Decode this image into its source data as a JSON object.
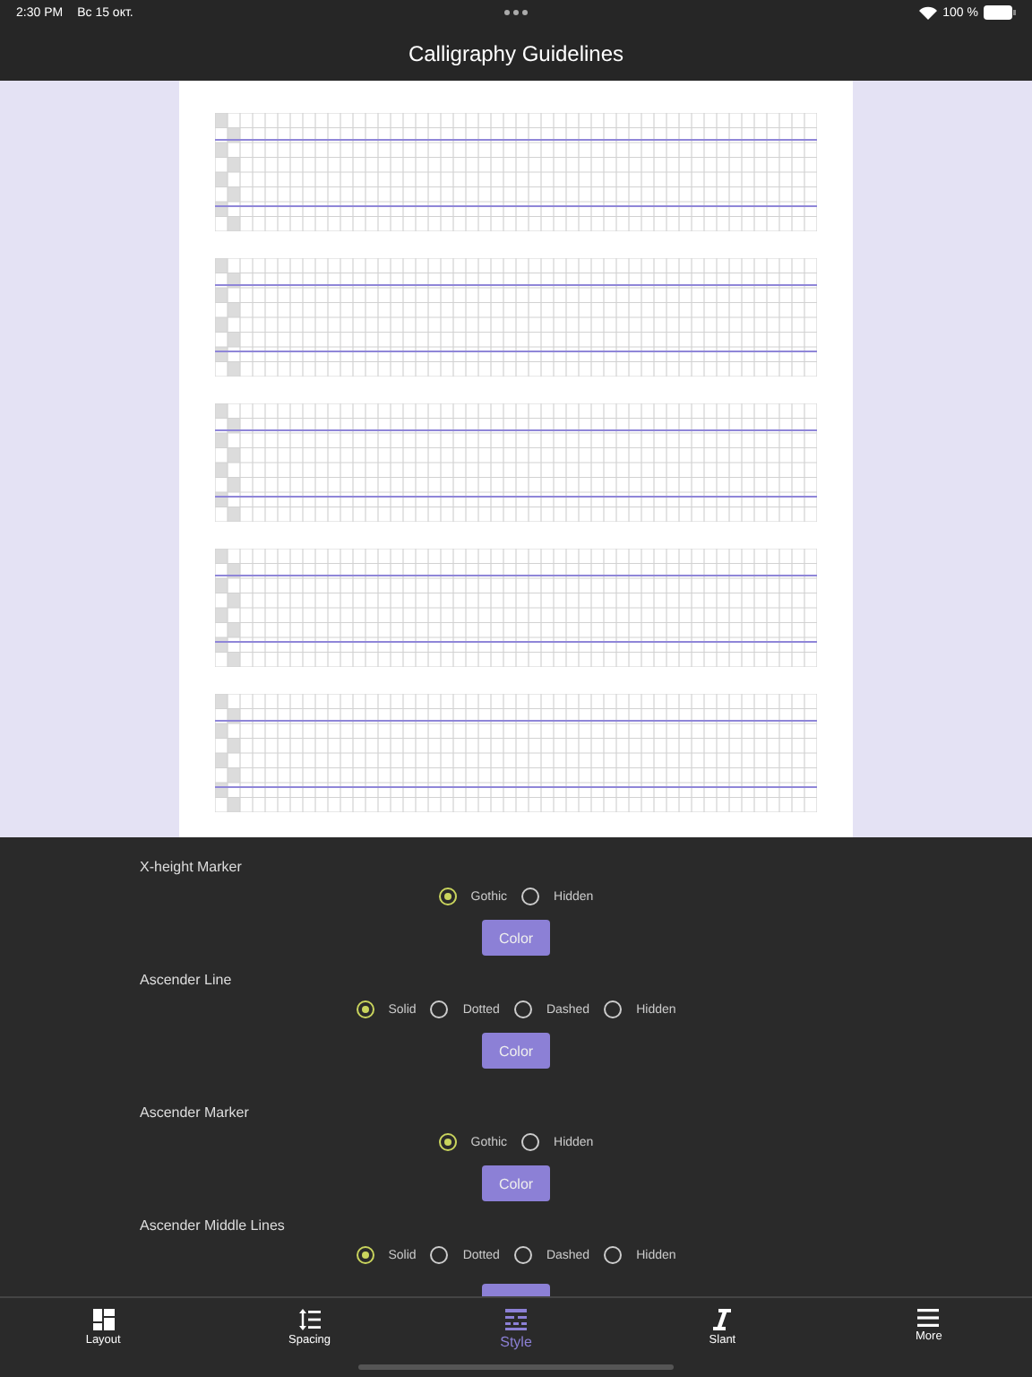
{
  "status_bar": {
    "time": "2:30 PM",
    "date": "Вс 15 окт.",
    "battery": "100 %"
  },
  "title": "Calligraphy Guidelines",
  "sheet": {
    "blocks": [
      {
        "kind": "grid"
      },
      {
        "kind": "grid"
      },
      {
        "kind": "grid"
      },
      {
        "kind": "grid"
      },
      {
        "kind": "grid"
      }
    ]
  },
  "settings": [
    {
      "label": "X-height Marker",
      "options": [
        {
          "label": "Gothic",
          "selected": true
        },
        {
          "label": "Hidden",
          "selected": false
        }
      ],
      "button": "Color"
    },
    {
      "label": "Ascender Line",
      "options": [
        {
          "label": "Solid",
          "selected": true
        },
        {
          "label": "Dotted",
          "selected": false
        },
        {
          "label": "Dashed",
          "selected": false
        },
        {
          "label": "Hidden",
          "selected": false
        }
      ],
      "button": "Color"
    },
    {
      "label": "Ascender Marker",
      "options": [
        {
          "label": "Gothic",
          "selected": true
        },
        {
          "label": "Hidden",
          "selected": false
        }
      ],
      "button": "Color"
    },
    {
      "label": "Ascender Middle Lines",
      "options": [
        {
          "label": "Solid",
          "selected": true
        },
        {
          "label": "Dotted",
          "selected": false
        },
        {
          "label": "Dashed",
          "selected": false
        },
        {
          "label": "Hidden",
          "selected": false
        }
      ],
      "button_stub": true
    }
  ],
  "tabs": [
    {
      "label": "Layout",
      "selected": false
    },
    {
      "label": "Spacing",
      "selected": false
    },
    {
      "label": "Style",
      "selected": true
    },
    {
      "label": "Slant",
      "selected": false
    },
    {
      "label": "More",
      "selected": false
    }
  ]
}
